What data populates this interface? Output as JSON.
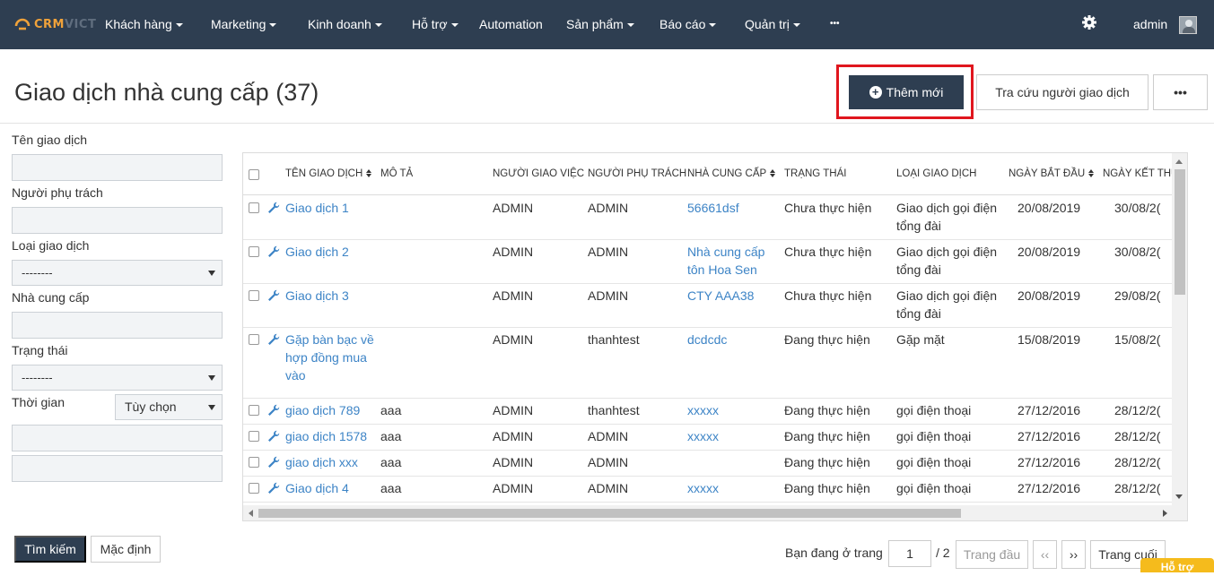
{
  "navbar": {
    "brand_a": "CRM",
    "brand_b": "VICT",
    "items": [
      {
        "label": "Khách hàng",
        "caret": true
      },
      {
        "label": "Marketing",
        "caret": true
      },
      {
        "label": "Kinh doanh",
        "caret": true
      },
      {
        "label": "Hỗ trợ",
        "caret": true
      },
      {
        "label": "Automation",
        "caret": false
      },
      {
        "label": "Sản phẩm",
        "caret": true
      },
      {
        "label": "Báo cáo",
        "caret": true
      },
      {
        "label": "Quản trị",
        "caret": true
      },
      {
        "label": "•••",
        "caret": false
      }
    ],
    "settings_icon": "gear-icon",
    "user": "admin"
  },
  "header": {
    "title": "Giao dịch nhà cung cấp (37)",
    "add_button": "Thêm mới",
    "lookup_button": "Tra cứu người giao dịch",
    "more_button": "•••"
  },
  "filters": {
    "name_label": "Tên giao dịch",
    "owner_label": "Người phụ trách",
    "type_label": "Loại giao dịch",
    "type_value": "--------",
    "supplier_label": "Nhà cung cấp",
    "status_label": "Trạng thái",
    "status_value": "--------",
    "time_label": "Thời gian",
    "time_value": "Tùy chọn",
    "search_button": "Tìm kiếm",
    "default_button": "Mặc định"
  },
  "table": {
    "columns": [
      "Tên giao dịch",
      "Mô tả",
      "Người giao việc",
      "Người phụ trách",
      "Nhà cung cấp",
      "Trạng thái",
      "Loại giao dịch",
      "Ngày bắt đầu",
      "Ngày kết thú"
    ],
    "rows": [
      {
        "name": "Giao dịch 1",
        "desc": "",
        "assigner": "ADMIN",
        "owner": "ADMIN",
        "supplier": "56661dsf",
        "status": "Chưa thực hiện",
        "type": "Giao dịch gọi điện tổng đài",
        "start": "20/08/2019",
        "end": "30/08/2("
      },
      {
        "name": "Giao dịch 2",
        "desc": "",
        "assigner": "ADMIN",
        "owner": "ADMIN",
        "supplier": "Nhà cung cấp tôn Hoa Sen",
        "status": "Chưa thực hiện",
        "type": "Giao dịch gọi điện tổng đài",
        "start": "20/08/2019",
        "end": "30/08/2("
      },
      {
        "name": "Giao dịch 3",
        "desc": "",
        "assigner": "ADMIN",
        "owner": "ADMIN",
        "supplier": "CTY AAA38",
        "status": "Chưa thực hiện",
        "type": "Giao dịch gọi điện tổng đài",
        "start": "20/08/2019",
        "end": "29/08/2("
      },
      {
        "name": "Gặp bàn bạc về hợp đồng mua vào",
        "desc": "",
        "assigner": "ADMIN",
        "owner": "thanhtest",
        "supplier": "dcdcdc",
        "status": "Đang thực hiện",
        "type": "Gặp mặt",
        "start": "15/08/2019",
        "end": "15/08/2("
      },
      {
        "name": "giao dịch 789",
        "desc": "aaa",
        "assigner": "ADMIN",
        "owner": "thanhtest",
        "supplier": "xxxxx",
        "status": "Đang thực hiện",
        "type": "gọi điện thoại",
        "start": "27/12/2016",
        "end": "28/12/2("
      },
      {
        "name": "giao dịch 1578",
        "desc": "aaa",
        "assigner": "ADMIN",
        "owner": "ADMIN",
        "supplier": "xxxxx",
        "status": "Đang thực hiện",
        "type": "gọi điện thoại",
        "start": "27/12/2016",
        "end": "28/12/2("
      },
      {
        "name": "giao dịch xxx",
        "desc": "aaa",
        "assigner": "ADMIN",
        "owner": "ADMIN",
        "supplier": "",
        "status": "Đang thực hiện",
        "type": "gọi điện thoại",
        "start": "27/12/2016",
        "end": "28/12/2("
      },
      {
        "name": "Giao dịch 4",
        "desc": "aaa",
        "assigner": "ADMIN",
        "owner": "ADMIN",
        "supplier": "xxxxx",
        "status": "Đang thực hiện",
        "type": "gọi điện thoại",
        "start": "27/12/2016",
        "end": "28/12/2("
      }
    ]
  },
  "pagination": {
    "label": "Bạn đang ở trang",
    "current": "1",
    "total": "/ 2",
    "first": "Trang đầu",
    "prev": "‹‹",
    "next": "››",
    "last": "Trang cuối"
  },
  "support_tab": "Hỗ trợ",
  "colors": {
    "navbar": "#2e3e51",
    "link": "#3d84c6",
    "highlight": "#e0161e",
    "support": "#f5bb1c"
  }
}
